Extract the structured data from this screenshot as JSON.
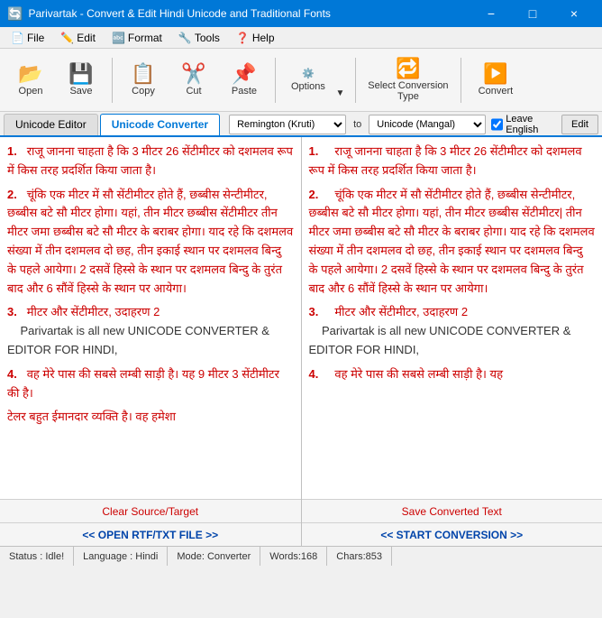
{
  "titlebar": {
    "title": "Parivartak - Convert & Edit Hindi Unicode and Traditional Fonts",
    "minimize": "−",
    "maximize": "□",
    "close": "×"
  },
  "menubar": {
    "items": [
      {
        "label": "File",
        "icon": "📄"
      },
      {
        "label": "Edit",
        "icon": "✏️"
      },
      {
        "label": "Format",
        "icon": "🔤"
      },
      {
        "label": "Tools",
        "icon": "🔧"
      },
      {
        "label": "Help",
        "icon": "❓"
      }
    ]
  },
  "toolbar": {
    "open_label": "Open",
    "save_label": "Save",
    "copy_label": "Copy",
    "cut_label": "Cut",
    "paste_label": "Paste",
    "options_label": "Options",
    "select_conversion_label": "Select Conversion Type",
    "convert_label": "Convert"
  },
  "tabs": {
    "unicode_editor": "Unicode Editor",
    "unicode_converter": "Unicode Converter"
  },
  "converter_controls": {
    "source_font": "Remington (Kruti)",
    "target_font": "Unicode (Mangal)",
    "to_label": "to",
    "leave_english_label": "Leave English",
    "leave_english_checked": true,
    "edit_label": "Edit"
  },
  "source_panel": {
    "text_lines": [
      {
        "num": "1.",
        "content": "राजू जानना चाहता है कि 3 मीटर 26 सेंटीमीटर को दशमलव रूप में किस तरह प्रदर्शित किया जाता है।"
      },
      {
        "num": "2.",
        "content": "चूंकि एक मीटर में सौ सेंटीमीटर होते हैं, छब्बीस सेन्टीमीटर, छब्बीस बटे सौ मीटर होगा। यहां, तीन मीटर छब्बीस सेंटीमीटर तीन मीटर जमा छब्बीस बटे सौ मीटर के बराबर होगा। याद रहे कि दशमलव संख्या में तीन दशमलव दो छह, तीन इकाई स्थान पर दशमलव बिन्दु के पहले आयेगा। 2 दसवें हिस्से के स्थान पर दशमलव बिन्दु के तुरंत बाद और 6 सौंवें हिस्से के स्थान पर आयेगा।"
      },
      {
        "num": "3.",
        "content": "मीटर और सेंटीमीटर, उदाहरण 2\nParivartak is all new UNICODE CONVERTER & EDITOR FOR HINDI,"
      },
      {
        "num": "4.",
        "content": "वह मेरे पास की सबसे लम्बी साड़ी है। यह 9 मीटर 3 सेंटीमीटर की है।"
      },
      {
        "num": "",
        "content": "टेलर बहुत ईमानदार व्यक्ति है। वह हमेशा"
      }
    ],
    "clear_btn": "Clear Source/Target",
    "open_btn": "<< OPEN RTF/TXT FILE >>"
  },
  "target_panel": {
    "text_lines": [
      {
        "num": "1.",
        "content": "राजू जानना चाहता है कि 3 मीटर 26 सेंटीमीटर को दशमलव रूप में किस तरह प्रदर्शित किया जाता है।"
      },
      {
        "num": "2.",
        "content": "चूंकि एक मीटर में सौ सेंटीमीटर होते हैं, छब्बीस सेन्टीमीटर, छब्बीस बटे सौ मीटर होगा। यहां, तीन मीटर छब्बीस सेंटीमीटर| तीन मीटर जमा छब्बीस बटे सौ मीटर के बराबर होगा। याद रहे कि दशमलव संख्या में तीन दशमलव दो छह, तीन इकाई स्थान पर दशमलव बिन्दु के पहले आयेगा। 2 दसवें हिस्से के स्थान पर दशमलव बिन्दु के तुरंत बाद और 6 सौंवें हिस्से के स्थान पर आयेगा।"
      },
      {
        "num": "3.",
        "content": "मीटर और सेंटीमीटर, उदाहरण 2\nParivartak is all new UNICODE CONVERTER & EDITOR FOR HINDI,"
      },
      {
        "num": "4.",
        "content": "वह मेरे पास की सबसे लम्बी साड़ी है। यह"
      }
    ],
    "save_btn": "Save Converted Text",
    "start_btn": "<< START CONVERSION >>"
  },
  "statusbar": {
    "status": "Status : Idle!",
    "language": "Language : Hindi",
    "mode": "Mode: Converter",
    "words": "Words:168",
    "chars": "Chars:853"
  }
}
